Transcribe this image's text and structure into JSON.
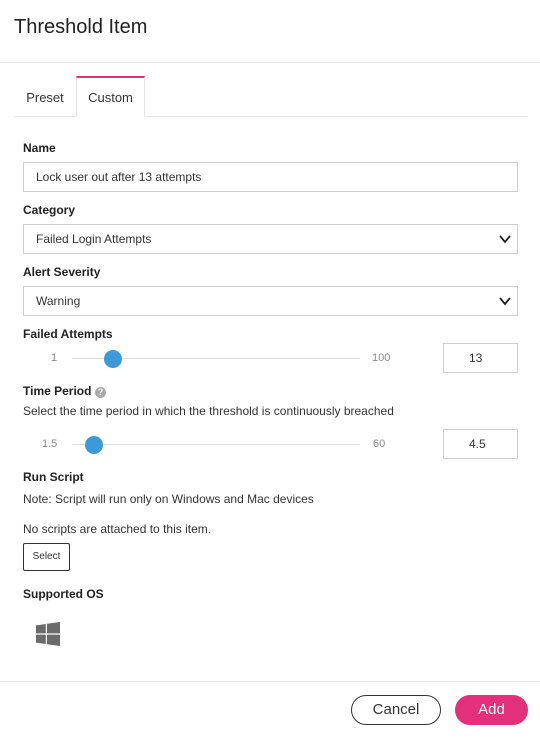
{
  "dialog": {
    "title": "Threshold Item"
  },
  "tabs": [
    {
      "label": "Preset",
      "active": false
    },
    {
      "label": "Custom",
      "active": true
    }
  ],
  "name": {
    "label": "Name",
    "value": "Lock user out after 13 attempts"
  },
  "category": {
    "label": "Category",
    "selected": "Failed Login Attempts"
  },
  "alert_severity": {
    "label": "Alert Severity",
    "selected": "Warning"
  },
  "failed_attempts": {
    "label": "Failed Attempts",
    "min": "1",
    "max": "100",
    "value": "13"
  },
  "time_period": {
    "label": "Time Period",
    "help": "?",
    "description": "Select the time period in which the threshold is continuously breached",
    "min": "1.5",
    "max": "60",
    "value": "4.5"
  },
  "run_script": {
    "label": "Run Script",
    "note": "Note: Script will run only on Windows and Mac devices",
    "empty_message": "No scripts are attached to this item.",
    "select_label": "Select"
  },
  "supported_os": {
    "label": "Supported OS",
    "icons": [
      "windows-icon"
    ]
  },
  "footer": {
    "cancel_label": "Cancel",
    "add_label": "Add"
  },
  "colors": {
    "accent": "#e2317a",
    "slider": "#3d9ad9",
    "border": "#cfcfcf"
  }
}
